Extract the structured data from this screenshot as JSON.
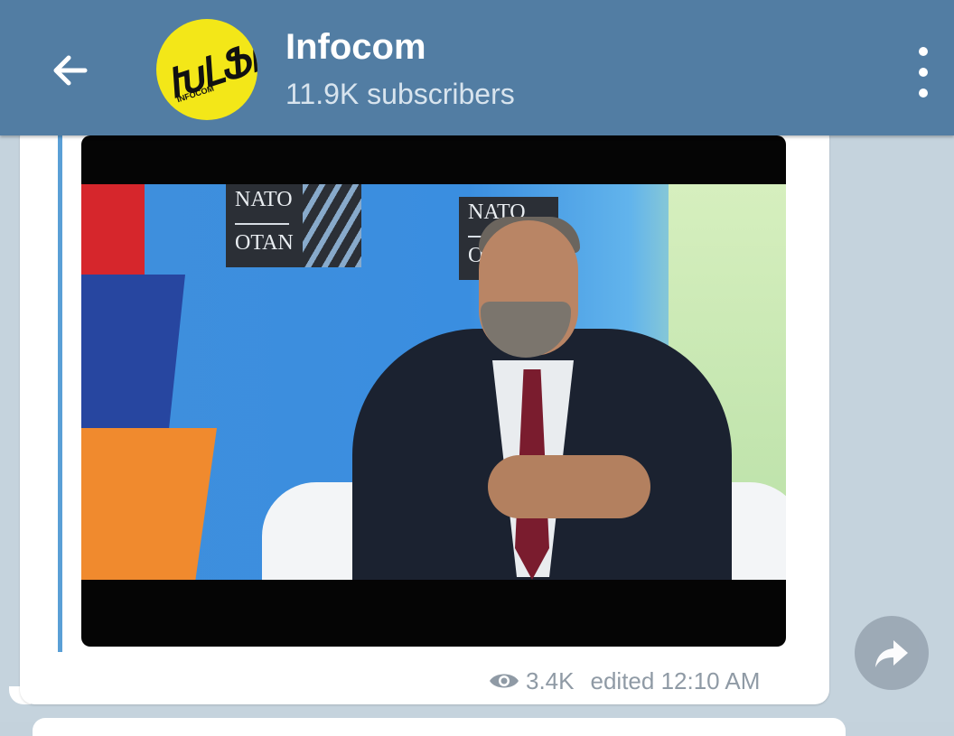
{
  "header": {
    "title": "Infocom",
    "subtitle": "11.9K subscribers",
    "avatar_text": "ԽԼՖՈ",
    "avatar_sub": "INFOCOM"
  },
  "post": {
    "video": {
      "overlay_text_1_top": "NATO",
      "overlay_text_1_bottom": "OTAN",
      "overlay_text_2_top": "NATO",
      "overlay_text_2_bottom": "OT"
    },
    "views": "3.4K",
    "edited_label": "edited 12:10 AM"
  },
  "colors": {
    "header": "#527da3",
    "quote_bar": "#5a9fd6",
    "meta_text": "#8f9aa5"
  },
  "icons": {
    "back": "arrow-left-icon",
    "menu": "more-vertical-icon",
    "views": "eye-icon",
    "share": "share-arrow-icon"
  }
}
